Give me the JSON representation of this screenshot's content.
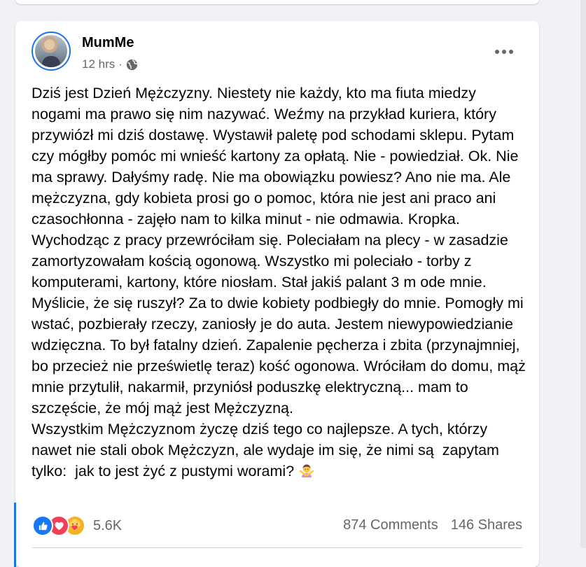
{
  "post": {
    "author": "MumMe",
    "time": "12 hrs",
    "separator": "·",
    "privacy_icon": "globe-icon",
    "more_icon": "more-options-icon",
    "text": "Dziś jest Dzień Mężczyzny. Niestety nie każdy, kto ma fiuta miedzy nogami ma prawo się nim nazywać. Weźmy na przykład kuriera, który przywiózł mi dziś dostawę. Wystawił paletę pod schodami sklepu. Pytam czy mógłby pomóc mi wnieść kartony za opłatą. Nie - powiedział. Ok. Nie ma sprawy. Dałyśmy radę. Nie ma obowiązku powiesz? Ano nie ma. Ale mężczyzna, gdy kobieta prosi go o pomoc, która nie jest ani praco ani czasochłonna - zajęło nam to kilka minut - nie odmawia. Kropka.\nWychodząc z pracy przewróciłam się. Poleciałam na plecy - w zasadzie zamortyzowałam kością ogonową. Wszystko mi poleciało - torby z komputerami, kartony, które niosłam. Stał jakiś palant 3 m ode mnie. Myślicie, że się ruszył? Za to dwie kobiety podbiegły do mnie. Pomogły mi wstać, pozbierały rzeczy, zaniosły je do auta. Jestem niewypowiedzianie wdzięczna. To był fatalny dzień. Zapalenie pęcherza i zbita (przynajmniej, bo przecież nie prześwietlę teraz) kość ogonowa. Wróciłam do domu, mąż mnie przytulił, nakarmił, przyniósł poduszkę elektryczną... mam to szczęście, że mój mąż jest Mężczyzną.\nWszystkim Mężczyznom życzę dziś tego co najlepsze. A tych, którzy nawet nie stali obok Mężczyzn, ale wydaje im się, że nimi są  zapytam tylko:  jak to jest żyć z pustymi worami?",
    "trailing_emoji": "woman-gesturing-no-emoji"
  },
  "engagement": {
    "reaction_icons": [
      "like-icon",
      "love-icon",
      "care-icon"
    ],
    "reaction_count": "5.6K",
    "comments": "874 Comments",
    "shares": "146 Shares"
  },
  "colors": {
    "background": "#f0f2f5",
    "card": "#ffffff",
    "accent": "#1877f2",
    "secondary_text": "#65676b",
    "primary_text": "#050505"
  }
}
